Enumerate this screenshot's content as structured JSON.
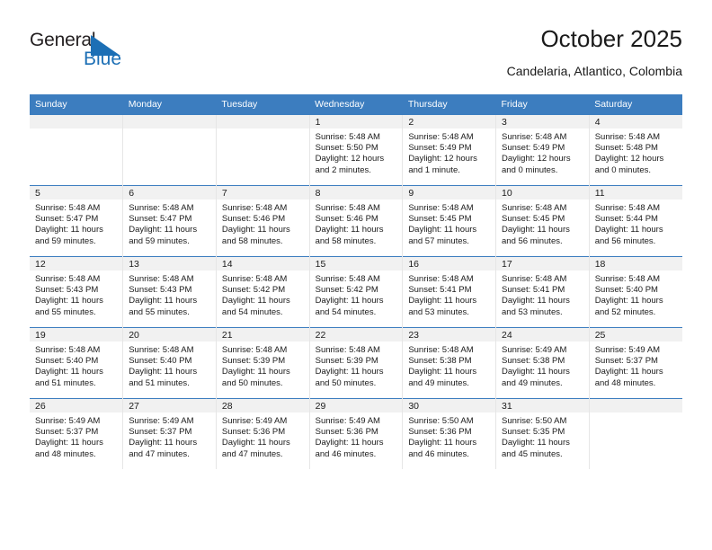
{
  "brand": {
    "name_top": "General",
    "name_bottom": "Blue",
    "accent_color": "#1c6fb5",
    "triangle_icon": "blue-triangle-icon"
  },
  "header": {
    "title": "October 2025",
    "subtitle": "Candelaria, Atlantico, Colombia"
  },
  "colors": {
    "header_row_bg": "#3C7DBF",
    "daynum_strip_bg": "#f1f1f1",
    "text": "#1a1a1a"
  },
  "weekdays": [
    "Sunday",
    "Monday",
    "Tuesday",
    "Wednesday",
    "Thursday",
    "Friday",
    "Saturday"
  ],
  "weeks": [
    [
      {
        "day": "",
        "lines": []
      },
      {
        "day": "",
        "lines": []
      },
      {
        "day": "",
        "lines": []
      },
      {
        "day": "1",
        "lines": [
          "Sunrise: 5:48 AM",
          "Sunset: 5:50 PM",
          "Daylight: 12 hours",
          "and 2 minutes."
        ]
      },
      {
        "day": "2",
        "lines": [
          "Sunrise: 5:48 AM",
          "Sunset: 5:49 PM",
          "Daylight: 12 hours",
          "and 1 minute."
        ]
      },
      {
        "day": "3",
        "lines": [
          "Sunrise: 5:48 AM",
          "Sunset: 5:49 PM",
          "Daylight: 12 hours",
          "and 0 minutes."
        ]
      },
      {
        "day": "4",
        "lines": [
          "Sunrise: 5:48 AM",
          "Sunset: 5:48 PM",
          "Daylight: 12 hours",
          "and 0 minutes."
        ]
      }
    ],
    [
      {
        "day": "5",
        "lines": [
          "Sunrise: 5:48 AM",
          "Sunset: 5:47 PM",
          "Daylight: 11 hours",
          "and 59 minutes."
        ]
      },
      {
        "day": "6",
        "lines": [
          "Sunrise: 5:48 AM",
          "Sunset: 5:47 PM",
          "Daylight: 11 hours",
          "and 59 minutes."
        ]
      },
      {
        "day": "7",
        "lines": [
          "Sunrise: 5:48 AM",
          "Sunset: 5:46 PM",
          "Daylight: 11 hours",
          "and 58 minutes."
        ]
      },
      {
        "day": "8",
        "lines": [
          "Sunrise: 5:48 AM",
          "Sunset: 5:46 PM",
          "Daylight: 11 hours",
          "and 58 minutes."
        ]
      },
      {
        "day": "9",
        "lines": [
          "Sunrise: 5:48 AM",
          "Sunset: 5:45 PM",
          "Daylight: 11 hours",
          "and 57 minutes."
        ]
      },
      {
        "day": "10",
        "lines": [
          "Sunrise: 5:48 AM",
          "Sunset: 5:45 PM",
          "Daylight: 11 hours",
          "and 56 minutes."
        ]
      },
      {
        "day": "11",
        "lines": [
          "Sunrise: 5:48 AM",
          "Sunset: 5:44 PM",
          "Daylight: 11 hours",
          "and 56 minutes."
        ]
      }
    ],
    [
      {
        "day": "12",
        "lines": [
          "Sunrise: 5:48 AM",
          "Sunset: 5:43 PM",
          "Daylight: 11 hours",
          "and 55 minutes."
        ]
      },
      {
        "day": "13",
        "lines": [
          "Sunrise: 5:48 AM",
          "Sunset: 5:43 PM",
          "Daylight: 11 hours",
          "and 55 minutes."
        ]
      },
      {
        "day": "14",
        "lines": [
          "Sunrise: 5:48 AM",
          "Sunset: 5:42 PM",
          "Daylight: 11 hours",
          "and 54 minutes."
        ]
      },
      {
        "day": "15",
        "lines": [
          "Sunrise: 5:48 AM",
          "Sunset: 5:42 PM",
          "Daylight: 11 hours",
          "and 54 minutes."
        ]
      },
      {
        "day": "16",
        "lines": [
          "Sunrise: 5:48 AM",
          "Sunset: 5:41 PM",
          "Daylight: 11 hours",
          "and 53 minutes."
        ]
      },
      {
        "day": "17",
        "lines": [
          "Sunrise: 5:48 AM",
          "Sunset: 5:41 PM",
          "Daylight: 11 hours",
          "and 53 minutes."
        ]
      },
      {
        "day": "18",
        "lines": [
          "Sunrise: 5:48 AM",
          "Sunset: 5:40 PM",
          "Daylight: 11 hours",
          "and 52 minutes."
        ]
      }
    ],
    [
      {
        "day": "19",
        "lines": [
          "Sunrise: 5:48 AM",
          "Sunset: 5:40 PM",
          "Daylight: 11 hours",
          "and 51 minutes."
        ]
      },
      {
        "day": "20",
        "lines": [
          "Sunrise: 5:48 AM",
          "Sunset: 5:40 PM",
          "Daylight: 11 hours",
          "and 51 minutes."
        ]
      },
      {
        "day": "21",
        "lines": [
          "Sunrise: 5:48 AM",
          "Sunset: 5:39 PM",
          "Daylight: 11 hours",
          "and 50 minutes."
        ]
      },
      {
        "day": "22",
        "lines": [
          "Sunrise: 5:48 AM",
          "Sunset: 5:39 PM",
          "Daylight: 11 hours",
          "and 50 minutes."
        ]
      },
      {
        "day": "23",
        "lines": [
          "Sunrise: 5:48 AM",
          "Sunset: 5:38 PM",
          "Daylight: 11 hours",
          "and 49 minutes."
        ]
      },
      {
        "day": "24",
        "lines": [
          "Sunrise: 5:49 AM",
          "Sunset: 5:38 PM",
          "Daylight: 11 hours",
          "and 49 minutes."
        ]
      },
      {
        "day": "25",
        "lines": [
          "Sunrise: 5:49 AM",
          "Sunset: 5:37 PM",
          "Daylight: 11 hours",
          "and 48 minutes."
        ]
      }
    ],
    [
      {
        "day": "26",
        "lines": [
          "Sunrise: 5:49 AM",
          "Sunset: 5:37 PM",
          "Daylight: 11 hours",
          "and 48 minutes."
        ]
      },
      {
        "day": "27",
        "lines": [
          "Sunrise: 5:49 AM",
          "Sunset: 5:37 PM",
          "Daylight: 11 hours",
          "and 47 minutes."
        ]
      },
      {
        "day": "28",
        "lines": [
          "Sunrise: 5:49 AM",
          "Sunset: 5:36 PM",
          "Daylight: 11 hours",
          "and 47 minutes."
        ]
      },
      {
        "day": "29",
        "lines": [
          "Sunrise: 5:49 AM",
          "Sunset: 5:36 PM",
          "Daylight: 11 hours",
          "and 46 minutes."
        ]
      },
      {
        "day": "30",
        "lines": [
          "Sunrise: 5:50 AM",
          "Sunset: 5:36 PM",
          "Daylight: 11 hours",
          "and 46 minutes."
        ]
      },
      {
        "day": "31",
        "lines": [
          "Sunrise: 5:50 AM",
          "Sunset: 5:35 PM",
          "Daylight: 11 hours",
          "and 45 minutes."
        ]
      },
      {
        "day": "",
        "lines": []
      }
    ]
  ]
}
